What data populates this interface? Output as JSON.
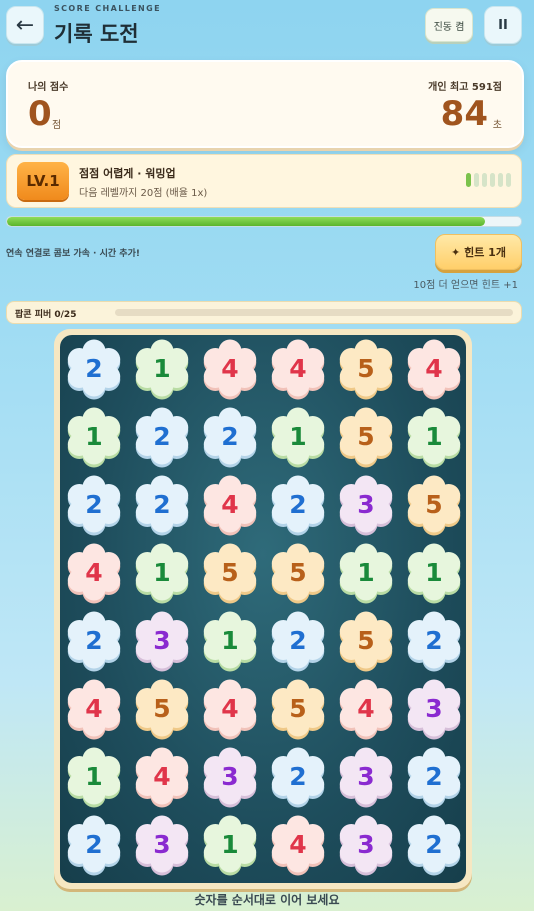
{
  "header": {
    "subtitle": "SCORE CHALLENGE",
    "title": "기록 도전",
    "back_icon": "←",
    "vibration_label": "진동 켬",
    "pause_icon": "II"
  },
  "score": {
    "label": "나의 점수",
    "value": "0",
    "unit": "점",
    "best_label": "개인 최고 591점",
    "time_value": "84",
    "time_unit": "초"
  },
  "level": {
    "badge": "LV.1",
    "title": "점점 어렵게 · 워밍업",
    "subtitle": "다음 레벨까지 20점 (배율 1x)",
    "pips_total": 6,
    "pips_filled": 1
  },
  "progress": {
    "fraction": 0.93
  },
  "combo_text": "연속 연결로 콤보 가속 · 시간 추가!",
  "hint": {
    "label": "✦ 힌트 1개",
    "note": "10점 더 얻으면 힌트 +1"
  },
  "fever": {
    "label": "팝콘 피버 0/25",
    "fraction": 0
  },
  "board": {
    "rows": [
      [
        2,
        1,
        4,
        4,
        5,
        4
      ],
      [
        1,
        2,
        2,
        1,
        5,
        1
      ],
      [
        2,
        2,
        4,
        2,
        3,
        5
      ],
      [
        4,
        1,
        5,
        5,
        1,
        1
      ],
      [
        2,
        3,
        1,
        2,
        5,
        2
      ],
      [
        4,
        5,
        4,
        5,
        4,
        3
      ],
      [
        1,
        4,
        3,
        2,
        3,
        2
      ],
      [
        2,
        3,
        1,
        4,
        3,
        2
      ]
    ],
    "colors": {
      "1": {
        "text": "#1a8a3a",
        "fill": "#e7f6dd",
        "edge": "#b9dca4"
      },
      "2": {
        "text": "#1f6fd1",
        "fill": "#e4f2fb",
        "edge": "#b3d3e8"
      },
      "3": {
        "text": "#8a2ad0",
        "fill": "#f3e6f4",
        "edge": "#d6bfd9"
      },
      "4": {
        "text": "#e0354a",
        "fill": "#fde6e2",
        "edge": "#f1c2b9"
      },
      "5": {
        "text": "#b8601a",
        "fill": "#fde9c4",
        "edge": "#efc988"
      }
    }
  },
  "footer": "숫자를 순서대로 이어 보세요"
}
